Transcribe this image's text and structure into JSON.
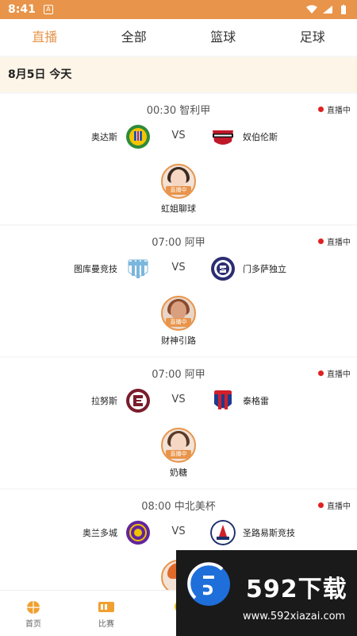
{
  "status_bar": {
    "time": "8:41",
    "notif": "A"
  },
  "tabs": [
    {
      "label": "直播"
    },
    {
      "label": "全部"
    },
    {
      "label": "篮球"
    },
    {
      "label": "足球"
    }
  ],
  "date_header": "8月5日  今天",
  "live_label": "直播中",
  "vs_label": "VS",
  "anchor_tag": "直播中",
  "matches": [
    {
      "time_league": "00:30  智利甲",
      "home": "奥达斯",
      "away": "奴伯伦斯",
      "anchor": "虹姐聊球"
    },
    {
      "time_league": "07:00  阿甲",
      "home": "图库曼竞技",
      "away": "门多萨独立",
      "anchor": "财神引路"
    },
    {
      "time_league": "07:00  阿甲",
      "home": "拉努斯",
      "away": "泰格雷",
      "anchor": "奶糖"
    },
    {
      "time_league": "08:00  中北美杯",
      "home": "奥兰多城",
      "away": "圣路易斯竞技",
      "anchor": ""
    }
  ],
  "bottom_nav": [
    {
      "label": "首页"
    },
    {
      "label": "比赛"
    }
  ],
  "watermark": {
    "title": "592下载",
    "url": "www.592xiazai.com"
  },
  "colors": {
    "accent": "#e8944a",
    "live_dot": "#e02020"
  }
}
